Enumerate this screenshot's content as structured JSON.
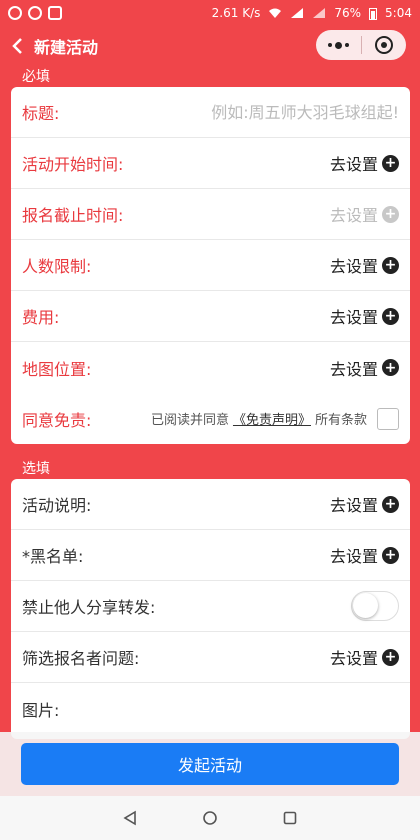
{
  "status_bar": {
    "speed": "2.61 K/s",
    "battery": "76%",
    "time": "5:04"
  },
  "nav": {
    "title": "新建活动"
  },
  "required_section": {
    "label": "必填",
    "title_label": "标题:",
    "title_placeholder": "例如:周五师大羽毛球组起!",
    "rows": [
      {
        "label": "活动开始时间:",
        "action": "去设置",
        "disabled": false
      },
      {
        "label": "报名截止时间:",
        "action": "去设置",
        "disabled": true
      },
      {
        "label": "人数限制:",
        "action": "去设置",
        "disabled": false
      },
      {
        "label": "费用:",
        "action": "去设置",
        "disabled": false
      },
      {
        "label": "地图位置:",
        "action": "去设置",
        "disabled": false
      }
    ],
    "disclaimer_label": "同意免责:",
    "disclaimer_prefix": "已阅读并同意",
    "disclaimer_link": "《免责声明》",
    "disclaimer_suffix": "所有条款"
  },
  "optional_section": {
    "label": "选填",
    "description_label": "活动说明:",
    "description_action": "去设置",
    "blacklist_label": "*黑名单:",
    "blacklist_action": "去设置",
    "share_label": "禁止他人分享转发:",
    "share_enabled": false,
    "filter_label": "筛选报名者问题:",
    "filter_action": "去设置",
    "image_label": "图片:"
  },
  "submit_label": "发起活动",
  "colors": {
    "brand": "#f0454a",
    "button": "#1a7cf5"
  }
}
